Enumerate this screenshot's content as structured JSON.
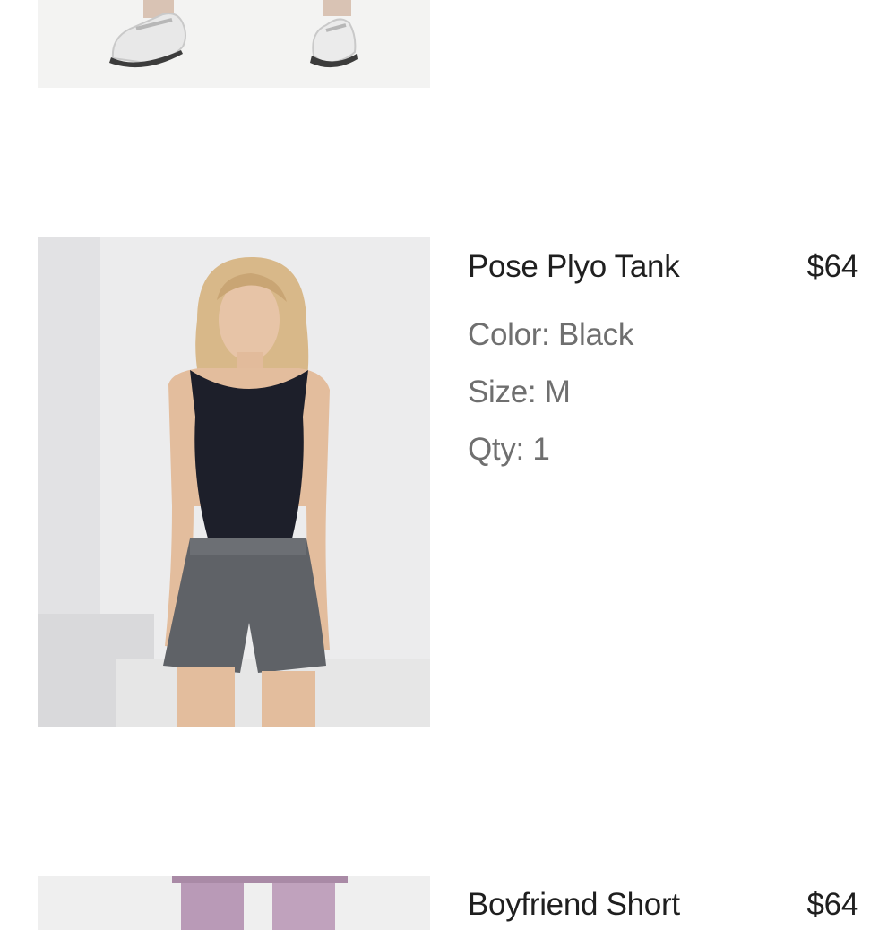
{
  "cart": {
    "items": [
      {
        "name": "",
        "price": "",
        "image_alt": "product-photo-sneakers"
      },
      {
        "name": "Pose Plyo Tank",
        "price": "$64",
        "color_line": "Color: Black",
        "size_line": "Size: M",
        "qty_line": "Qty: 1",
        "image_alt": "product-photo-tank"
      },
      {
        "name": "Boyfriend Short",
        "price": "$64",
        "image_alt": "product-photo-shorts"
      }
    ]
  },
  "colors": {
    "text_primary": "#1f1f1f",
    "text_secondary": "#6f6f6f",
    "background": "#ffffff"
  }
}
